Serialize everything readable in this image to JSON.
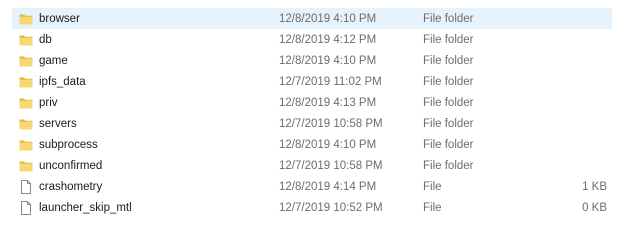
{
  "files": [
    {
      "name": "browser",
      "date": "12/8/2019 4:10 PM",
      "type": "File folder",
      "size": "",
      "icon": "folder-icon",
      "selected": true
    },
    {
      "name": "db",
      "date": "12/8/2019 4:12 PM",
      "type": "File folder",
      "size": "",
      "icon": "folder-icon",
      "selected": false
    },
    {
      "name": "game",
      "date": "12/8/2019 4:10 PM",
      "type": "File folder",
      "size": "",
      "icon": "folder-icon",
      "selected": false
    },
    {
      "name": "ipfs_data",
      "date": "12/7/2019 11:02 PM",
      "type": "File folder",
      "size": "",
      "icon": "folder-icon",
      "selected": false
    },
    {
      "name": "priv",
      "date": "12/8/2019 4:13 PM",
      "type": "File folder",
      "size": "",
      "icon": "folder-icon",
      "selected": false
    },
    {
      "name": "servers",
      "date": "12/7/2019 10:58 PM",
      "type": "File folder",
      "size": "",
      "icon": "folder-icon",
      "selected": false
    },
    {
      "name": "subprocess",
      "date": "12/8/2019 4:10 PM",
      "type": "File folder",
      "size": "",
      "icon": "folder-icon",
      "selected": false
    },
    {
      "name": "unconfirmed",
      "date": "12/7/2019 10:58 PM",
      "type": "File folder",
      "size": "",
      "icon": "folder-icon",
      "selected": false
    },
    {
      "name": "crashometry",
      "date": "12/8/2019 4:14 PM",
      "type": "File",
      "size": "1 KB",
      "icon": "file-icon",
      "selected": false
    },
    {
      "name": "launcher_skip_mtl",
      "date": "12/7/2019 10:52 PM",
      "type": "File",
      "size": "0 KB",
      "icon": "file-icon",
      "selected": false
    }
  ],
  "colors": {
    "folder": "#f8d775",
    "folder_dark": "#e6b43c",
    "selection": "#e5f3ff",
    "text": "#1a1a1a",
    "meta_text": "#6d6d6d"
  }
}
